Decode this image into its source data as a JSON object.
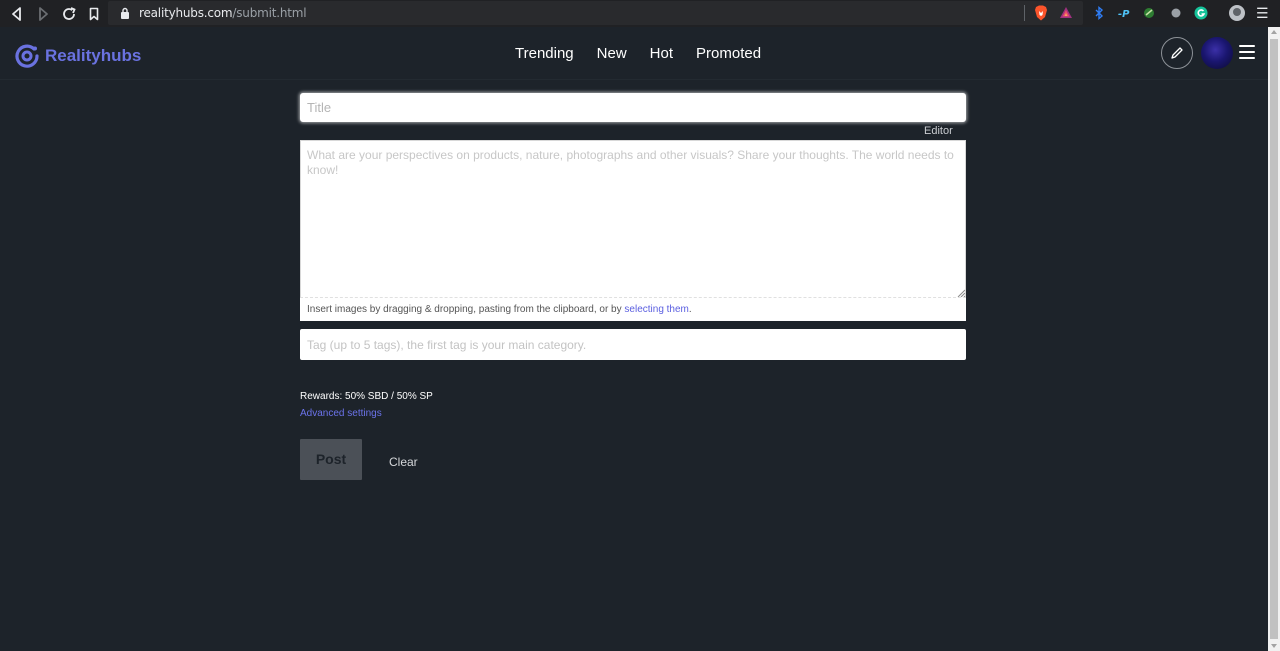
{
  "browser": {
    "url_domain": "realityhubs.com",
    "url_path": "/submit.html"
  },
  "header": {
    "logo_text": "Realityhubs",
    "nav": [
      "Trending",
      "New",
      "Hot",
      "Promoted"
    ]
  },
  "form": {
    "title_placeholder": "Title",
    "editor_label": "Editor",
    "body_placeholder": "What are your perspectives on products, nature, photographs and other visuals? Share your thoughts. The world needs to know!",
    "dropzone_text": "Insert images by dragging & dropping, pasting from the clipboard, or by ",
    "dropzone_link": "selecting them",
    "dropzone_end": ".",
    "tags_placeholder": "Tag (up to 5 tags), the first tag is your main category.",
    "rewards_text": "Rewards: 50% SBD / 50% SP",
    "advanced_label": "Advanced settings",
    "post_label": "Post",
    "clear_label": "Clear"
  },
  "colors": {
    "background": "#1d232a",
    "accent": "#6a72e0",
    "link": "#5b5fe0",
    "post_button": "#4b5057"
  },
  "icons": [
    "back-icon",
    "forward-icon",
    "reload-icon",
    "bookmark-icon",
    "lock-icon",
    "brave-shield-icon",
    "brave-rewards-icon",
    "extension-icons",
    "profile-icon",
    "menu-icon",
    "realityhubs-logo-icon",
    "pencil-icon",
    "hamburger-icon"
  ]
}
